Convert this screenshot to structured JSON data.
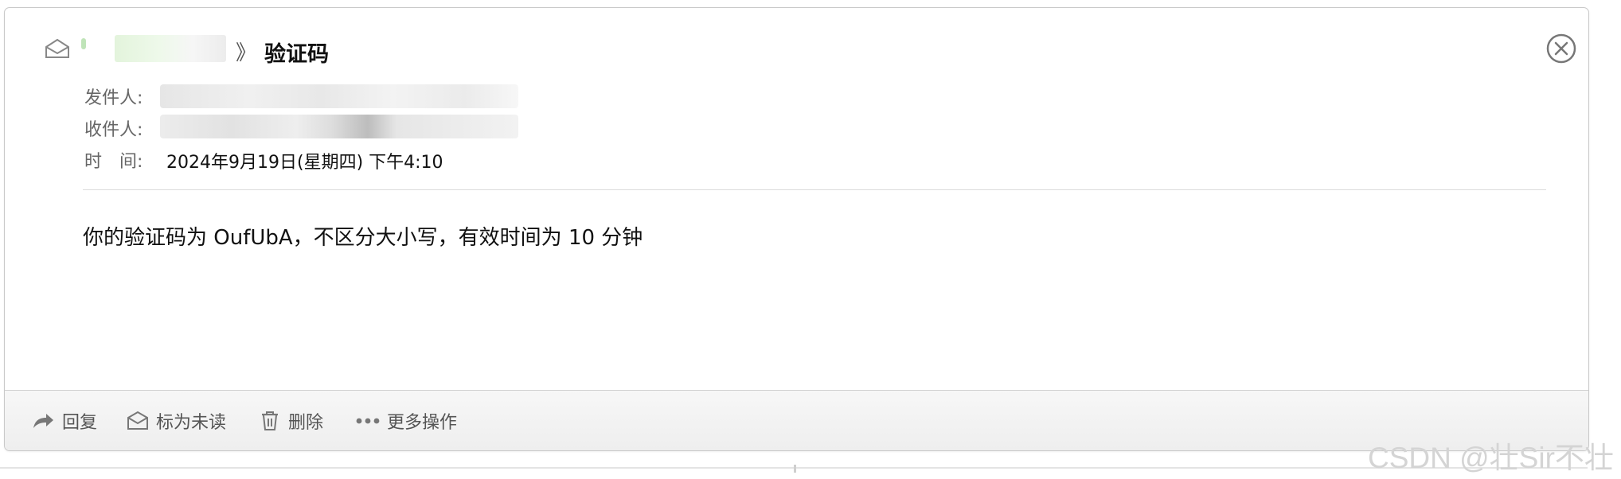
{
  "email": {
    "subject": "验证码",
    "meta": {
      "from_label": "发件人:",
      "to_label": "收件人:",
      "time_label": "时　间:",
      "time_value": "2024年9月19日(星期四) 下午4:10"
    },
    "body": "你的验证码为 OufUbA，不区分大小写，有效时间为 10 分钟"
  },
  "footer": {
    "reply_label": "回复",
    "mark_unread_label": "标为未读",
    "delete_label": "删除",
    "more_label": "更多操作"
  },
  "watermark": "CSDN @壮Sir不壮",
  "icons": {
    "header": "envelope-open-icon",
    "close": "close-circle-icon",
    "reply": "reply-arrow-icon",
    "mark_unread": "envelope-icon",
    "delete": "trash-icon",
    "more": "ellipsis-icon"
  },
  "colors": {
    "border": "#c9c9c9",
    "footer_bg": "#eeeeee",
    "text_muted": "#666666",
    "text_main": "#111111"
  }
}
